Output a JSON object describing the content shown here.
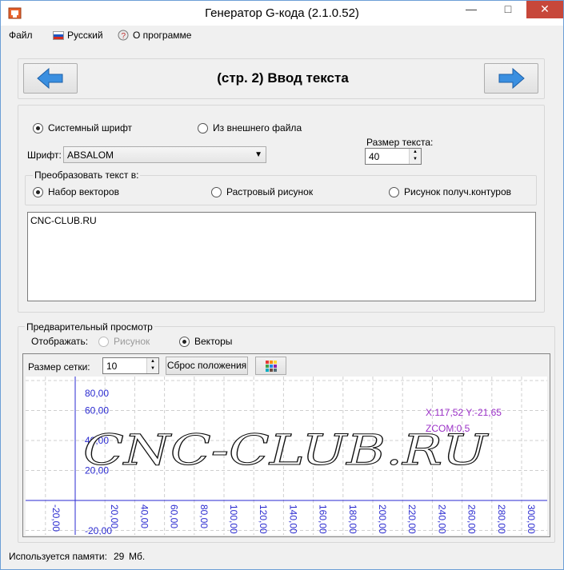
{
  "window": {
    "title": "Генератор G-кода (2.1.0.52)",
    "minimize": "—",
    "maximize": "□",
    "close": "✕"
  },
  "menu": {
    "file": "Файл",
    "language": "Русский",
    "about": "О программе"
  },
  "header": {
    "page_title": "(стр. 2) Ввод текста"
  },
  "font_source": {
    "system_font_label": "Системный шрифт",
    "external_file_label": "Из внешнего файла",
    "selected": "system"
  },
  "font": {
    "label": "Шрифт:",
    "value": "ABSALOM"
  },
  "text_size": {
    "label": "Размер текста:",
    "value": "40"
  },
  "convert": {
    "legend": "Преобразовать текст в:",
    "options": [
      "Набор векторов",
      "Растровый рисунок",
      "Рисунок получ.контуров"
    ],
    "selected": 0
  },
  "input_text": "CNC-CLUB.RU",
  "preview": {
    "legend": "Предварительный просмотр",
    "display_label": "Отображать:",
    "picture_label": "Рисунок",
    "vectors_label": "Векторы",
    "selected": "vectors",
    "grid_size_label": "Размер сетки:",
    "grid_size_value": "10",
    "reset_button": "Сброс положения",
    "plot": {
      "y_ticks": [
        "80,00",
        "60,00",
        "40,00",
        "20,00"
      ],
      "y_neg_tick": "-20,00",
      "x_ticks": [
        "-20,00",
        "20,00",
        "40,00",
        "60,00",
        "80,00",
        "100,00",
        "120,00",
        "140,00",
        "160,00",
        "180,00",
        "200,00",
        "220,00",
        "240,00",
        "260,00",
        "280,00",
        "300,00"
      ],
      "x_neg_tick": "-20,00",
      "coord_readout": "X:117,52 Y:-21,65",
      "zcom_readout": "ZCOM:0,5",
      "preview_text": "CNC-CLUB.RU"
    }
  },
  "status": {
    "memory_label": "Используется памяти:",
    "memory_value": "29",
    "memory_unit": "Мб."
  },
  "colors": {
    "accent_blue": "#3a8fe0",
    "axis_blue": "#2a2ad0",
    "readout_purple": "#9b30c7",
    "close_red": "#c7473a"
  }
}
